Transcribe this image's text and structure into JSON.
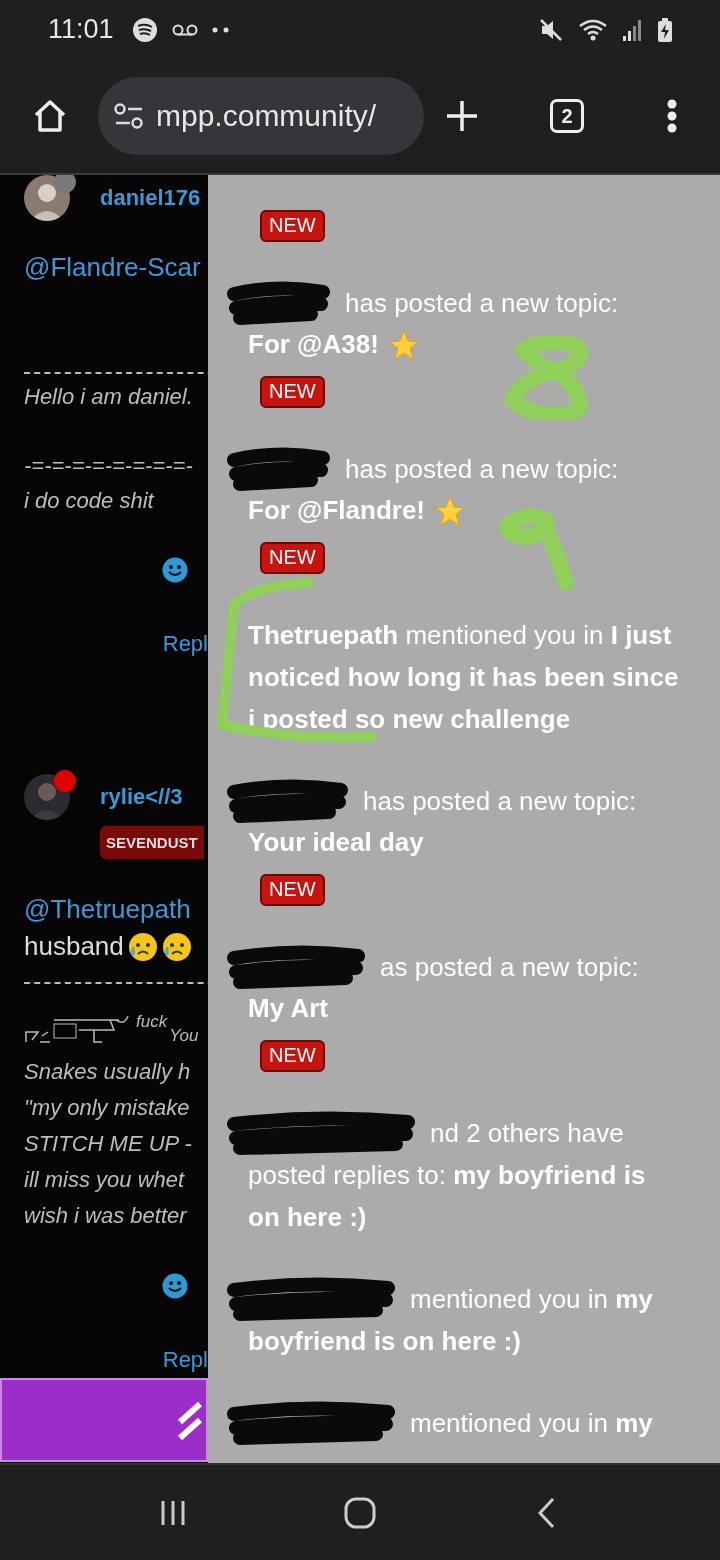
{
  "status_bar": {
    "time": "11:01"
  },
  "browser": {
    "url": "mpp.community/",
    "tab_count": "2"
  },
  "posts": [
    {
      "username": "daniel176",
      "color": "#7a7a7a",
      "mention": "@Flandre-Scar",
      "signature": [
        "Hello i am daniel.",
        "-=-=-=-=-=-=-=-=-",
        "i do code shit"
      ],
      "reply": "Repl"
    },
    {
      "username": "rylie<//3",
      "color": "#e00000",
      "badge": "SEVENDUST",
      "mention": "@Thetruepath",
      "body": "husband",
      "reactions": [
        {
          "kind": "worried"
        },
        {
          "kind": "worried"
        }
      ],
      "ascii": {
        "word": "fuck",
        "sub": "You"
      },
      "signature": [
        "Snakes usually h",
        "\"my only mistake",
        "STITCH ME UP - ",
        "ill miss you whet",
        "wish i was better"
      ],
      "reply": "Repl"
    }
  ],
  "notifications": [
    {
      "kind": "continued",
      "badge": "NEW"
    },
    {
      "kind": "new_topic",
      "redacted": true,
      "text": "has posted a new topic:",
      "topic": "For @A38!",
      "star": true,
      "badge": "NEW"
    },
    {
      "kind": "new_topic",
      "redacted": true,
      "text": "has posted a new topic:",
      "topic": "For @Flandre!",
      "star": true,
      "badge": "NEW"
    },
    {
      "kind": "mention",
      "text": "**Thetruepath** mentioned you in **I just noticed how long it has been since i posted so new challenge**"
    },
    {
      "kind": "new_topic",
      "redacted": true,
      "text": "has posted a new topic:",
      "topic": "Your ideal day",
      "badge": "NEW"
    },
    {
      "kind": "new_topic",
      "redacted": true,
      "text": "as posted a new topic:",
      "topic": "My Art",
      "badge": "NEW"
    },
    {
      "kind": "mention",
      "redacted": true,
      "text": "nd 2 others have posted replies to: **my boyfriend is on here :)**"
    },
    {
      "kind": "mention",
      "redacted": true,
      "text": "mentioned you in **my boyfriend is on here :)**"
    },
    {
      "kind": "mention",
      "redacted": true,
      "text": "mentioned you in **my**"
    }
  ]
}
